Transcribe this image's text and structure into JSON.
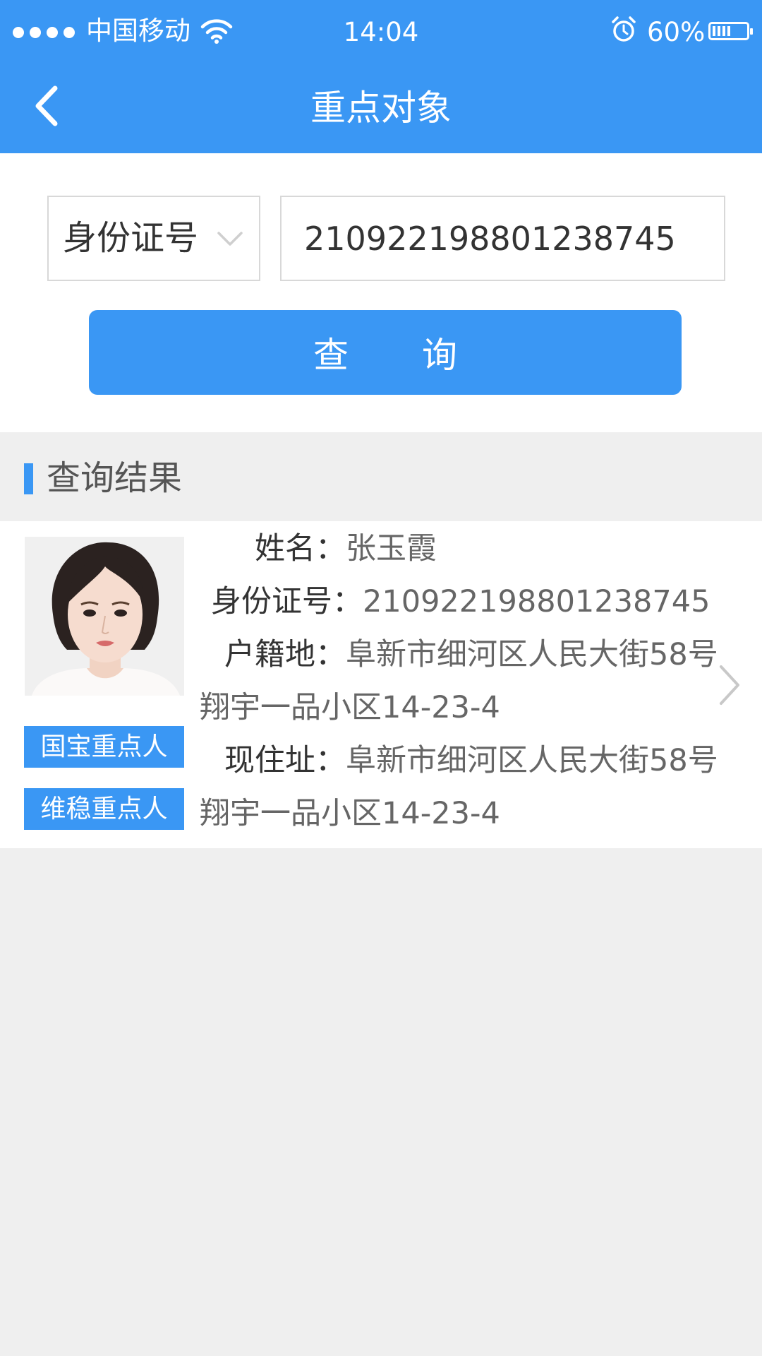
{
  "status_bar": {
    "carrier": "中国移动",
    "time": "14:04",
    "battery": "60%",
    "battery_level": 0.6
  },
  "nav": {
    "title": "重点对象",
    "back_icon": "chevron-left-icon"
  },
  "search": {
    "type_label": "身份证号",
    "id_value": "210922198801238745",
    "query_label": "查 询"
  },
  "section": {
    "title": "查询结果"
  },
  "result": {
    "name_label": "姓名",
    "name_value": "张玉霞",
    "id_label": "身份证号",
    "id_value": "210922198801238745",
    "huji_label": "户籍地",
    "huji_value_line1": "阜新市细河区人民大街58号",
    "huji_value_line2": "翔宇一品小区14-23-4",
    "current_label": "现住址",
    "current_value_line1": "阜新市细河区人民大街58号",
    "current_value_line2": "翔宇一品小区14-23-4",
    "colon": "：",
    "tags": [
      "国宝重点人",
      "维稳重点人"
    ]
  },
  "colors": {
    "accent": "#3a97f4",
    "background": "#efefef"
  }
}
